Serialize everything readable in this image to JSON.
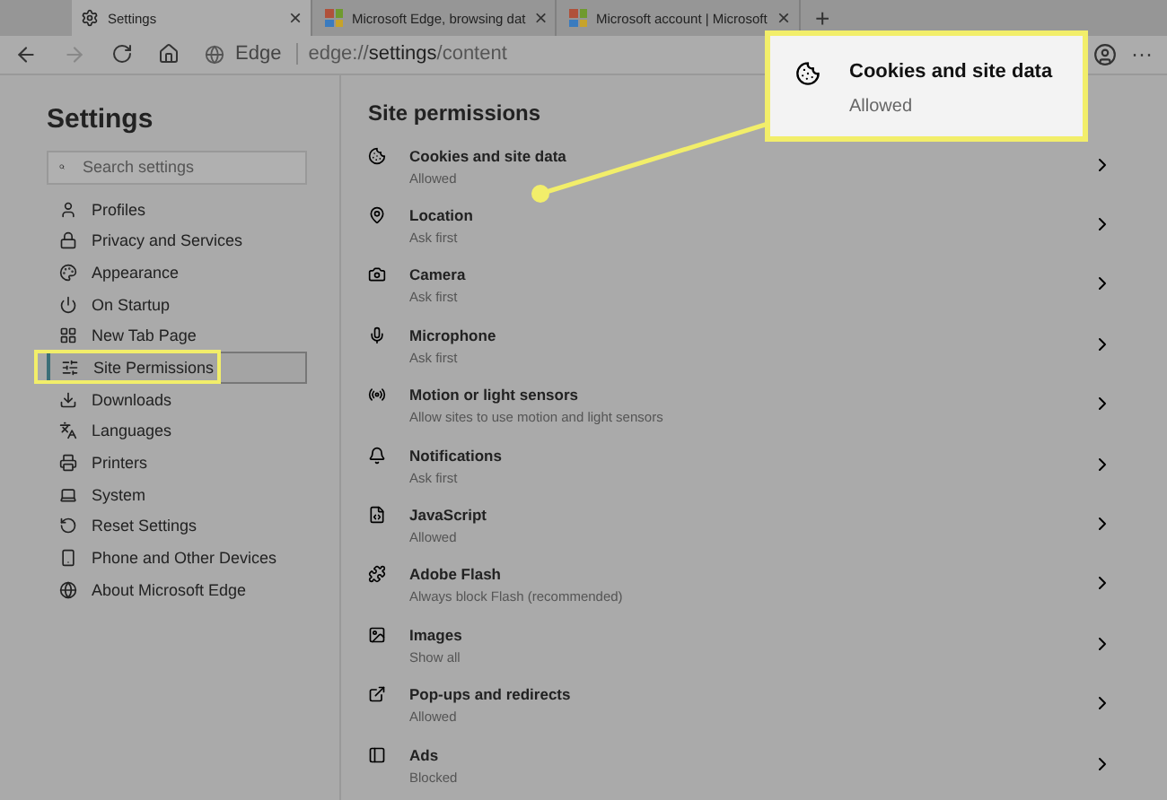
{
  "tabs": [
    {
      "title": "Settings",
      "selected": true,
      "close": "×"
    },
    {
      "title": "Microsoft Edge, browsing dat",
      "selected": false,
      "close": "×"
    },
    {
      "title": "Microsoft account | Microsoft",
      "selected": false,
      "close": "×"
    }
  ],
  "new_tab": "+",
  "address_bar": {
    "site_label": "Edge",
    "url_prefix": "edge://",
    "url_bold": "settings",
    "url_suffix": "/content"
  },
  "more_menu": "···",
  "sidebar": {
    "title": "Settings",
    "search": {
      "placeholder": "Search settings"
    },
    "items": [
      {
        "label": "Profiles",
        "selected": false
      },
      {
        "label": "Privacy and Services",
        "selected": false
      },
      {
        "label": "Appearance",
        "selected": false
      },
      {
        "label": "On Startup",
        "selected": false
      },
      {
        "label": "New Tab Page",
        "selected": false
      },
      {
        "label": "Site Permissions",
        "selected": true
      },
      {
        "label": "Downloads",
        "selected": false
      },
      {
        "label": "Languages",
        "selected": false
      },
      {
        "label": "Printers",
        "selected": false
      },
      {
        "label": "System",
        "selected": false
      },
      {
        "label": "Reset Settings",
        "selected": false
      },
      {
        "label": "Phone and Other Devices",
        "selected": false
      },
      {
        "label": "About Microsoft Edge",
        "selected": false
      }
    ]
  },
  "main": {
    "title": "Site permissions",
    "items": [
      {
        "label": "Cookies and site data",
        "status": "Allowed"
      },
      {
        "label": "Location",
        "status": "Ask first"
      },
      {
        "label": "Camera",
        "status": "Ask first"
      },
      {
        "label": "Microphone",
        "status": "Ask first"
      },
      {
        "label": "Motion or light sensors",
        "status": "Allow sites to use motion and light sensors"
      },
      {
        "label": "Notifications",
        "status": "Ask first"
      },
      {
        "label": "JavaScript",
        "status": "Allowed"
      },
      {
        "label": "Adobe Flash",
        "status": "Always block Flash (recommended)"
      },
      {
        "label": "Images",
        "status": "Show all"
      },
      {
        "label": "Pop-ups and redirects",
        "status": "Allowed"
      },
      {
        "label": "Ads",
        "status": "Blocked"
      }
    ]
  },
  "callout": {
    "title": "Cookies and site data",
    "status": "Allowed"
  }
}
